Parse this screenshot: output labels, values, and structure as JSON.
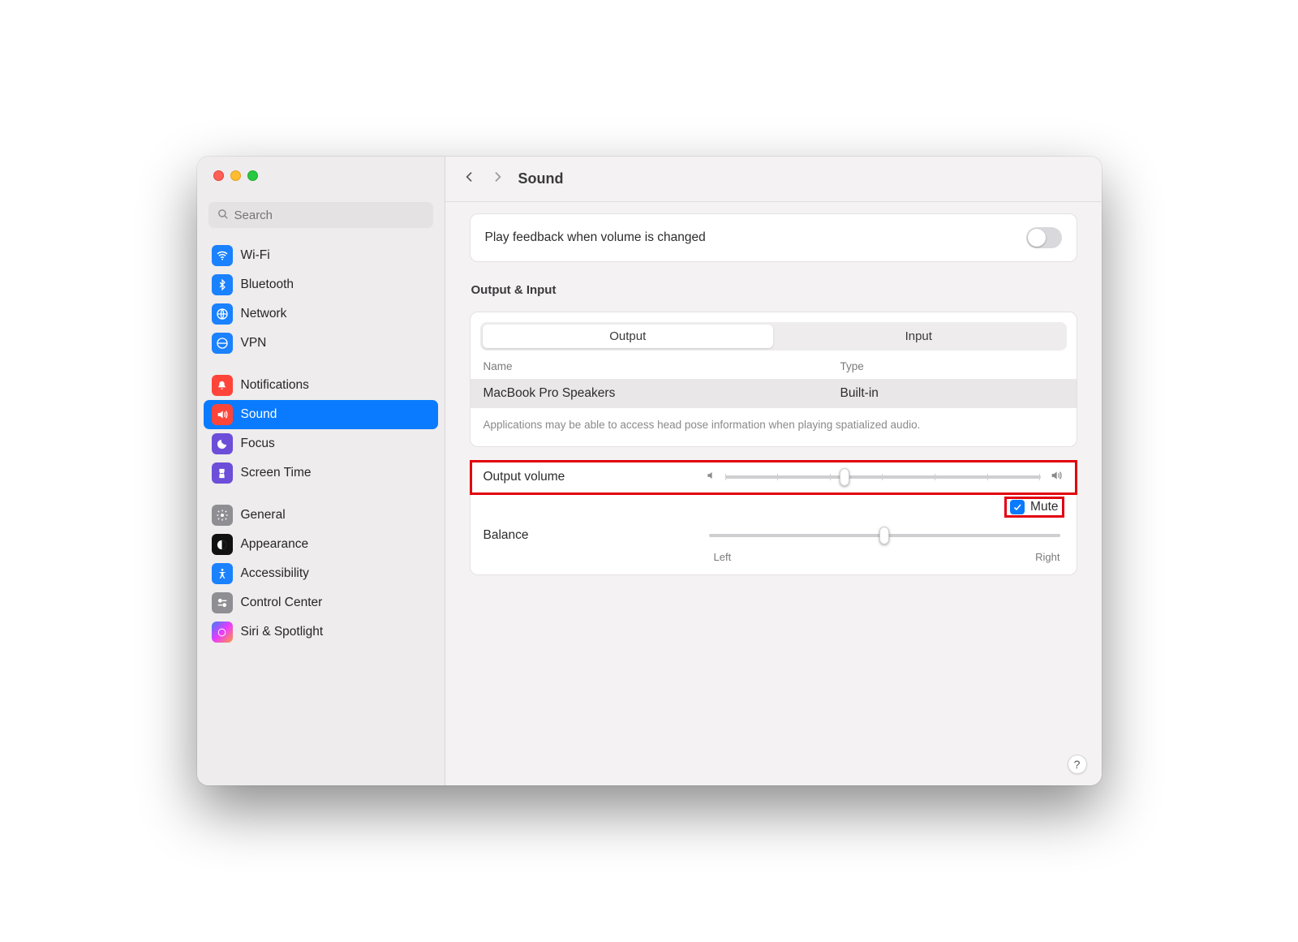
{
  "window": {
    "title": "Sound"
  },
  "search": {
    "placeholder": "Search"
  },
  "sidebar": {
    "items": [
      {
        "label": "Wi-Fi"
      },
      {
        "label": "Bluetooth"
      },
      {
        "label": "Network"
      },
      {
        "label": "VPN"
      },
      {
        "label": "Notifications"
      },
      {
        "label": "Sound"
      },
      {
        "label": "Focus"
      },
      {
        "label": "Screen Time"
      },
      {
        "label": "General"
      },
      {
        "label": "Appearance"
      },
      {
        "label": "Accessibility"
      },
      {
        "label": "Control Center"
      },
      {
        "label": "Siri & Spotlight"
      }
    ]
  },
  "playFeedback": {
    "label": "Play feedback when volume is changed",
    "enabled": false
  },
  "outputInput": {
    "heading": "Output & Input",
    "tabs": {
      "output": "Output",
      "input": "Input",
      "selected": "Output"
    },
    "columns": {
      "name": "Name",
      "type": "Type"
    },
    "rows": [
      {
        "name": "MacBook Pro Speakers",
        "type": "Built-in"
      }
    ],
    "hint": "Applications may be able to access head pose information when playing spatialized audio."
  },
  "outputVolume": {
    "label": "Output volume",
    "value_percent": 38,
    "mute_label": "Mute",
    "mute": true
  },
  "balance": {
    "label": "Balance",
    "left_label": "Left",
    "right_label": "Right",
    "value_percent": 50
  },
  "help": {
    "label": "?"
  }
}
